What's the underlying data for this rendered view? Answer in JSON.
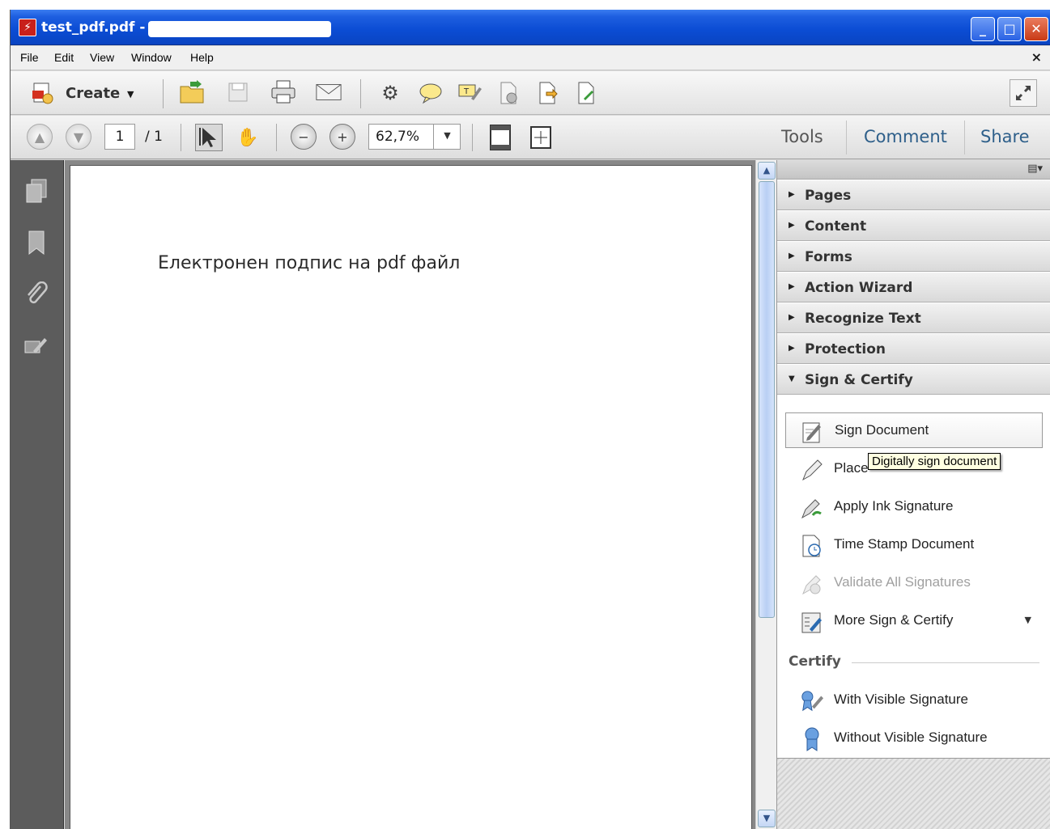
{
  "window": {
    "title": "test_pdf.pdf -"
  },
  "menu": {
    "items": [
      "File",
      "Edit",
      "View",
      "Window",
      "Help"
    ],
    "close_glyph": "×"
  },
  "toolbar": {
    "create_label": "Create",
    "icons": [
      "create-icon",
      "open-icon",
      "save-icon",
      "print-icon",
      "email-icon",
      "settings-icon",
      "comment-icon",
      "highlight-icon",
      "redact-icon",
      "export-icon",
      "sign-icon",
      "expand-icon"
    ]
  },
  "navigation": {
    "current_page": "1",
    "total_pages": "/ 1",
    "zoom": "62,7%"
  },
  "tabs": {
    "tools": "Tools",
    "comment": "Comment",
    "share": "Share"
  },
  "document": {
    "text": "Електронен подпис на pdf файл"
  },
  "panel": {
    "sections": [
      "Pages",
      "Content",
      "Forms",
      "Action Wizard",
      "Recognize Text",
      "Protection",
      "Sign & Certify"
    ],
    "sign_tools": [
      {
        "label": "Sign Document",
        "icon": "sign-document-icon"
      },
      {
        "label": "Place",
        "icon": "pen-icon"
      },
      {
        "label": "Apply Ink Signature",
        "icon": "ink-signature-icon"
      },
      {
        "label": "Time Stamp Document",
        "icon": "time-stamp-icon"
      },
      {
        "label": "Validate All Signatures",
        "icon": "validate-icon"
      },
      {
        "label": "More Sign & Certify",
        "icon": "more-sign-icon"
      }
    ],
    "certify_heading": "Certify",
    "certify_tools": [
      {
        "label": "With Visible Signature",
        "icon": "visible-signature-icon"
      },
      {
        "label": "Without Visible Signature",
        "icon": "ribbon-icon"
      }
    ],
    "tooltip": "Digitally sign document"
  },
  "colors": {
    "titlebar": "#0b4cd3",
    "tab_accent": "#2e5f8a",
    "disabled_text": "#a0a0a0"
  }
}
